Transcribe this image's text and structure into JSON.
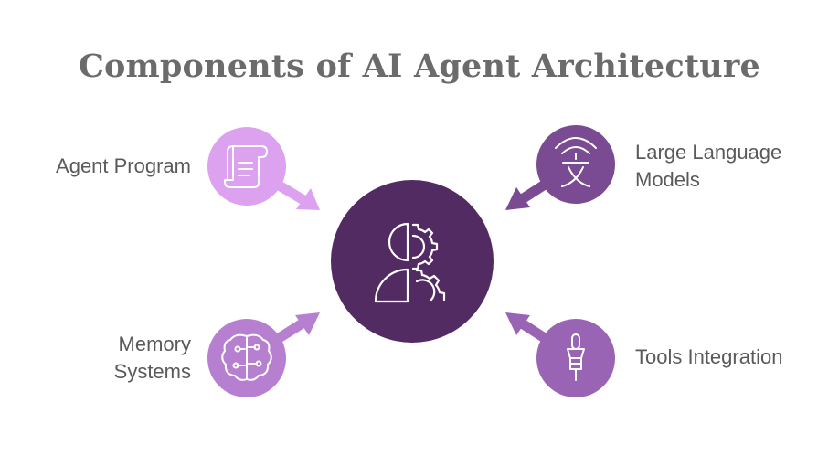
{
  "title": "Components of AI Agent Architecture",
  "center": {
    "icon": "head-gear-icon"
  },
  "components": [
    {
      "id": "agent-program",
      "label": "Agent Program",
      "icon": "scroll-icon",
      "color": "#dca2f0"
    },
    {
      "id": "llm",
      "label_lines": [
        "Large Language",
        "Models"
      ],
      "icon": "language-signal-icon",
      "color": "#7a4a92"
    },
    {
      "id": "memory",
      "label_lines": [
        "Memory",
        "Systems"
      ],
      "icon": "brain-circuit-icon",
      "color": "#b77fd0"
    },
    {
      "id": "tools",
      "label": "Tools Integration",
      "icon": "tool-plug-icon",
      "color": "#9a64b4"
    }
  ],
  "colors": {
    "center": "#532b63",
    "title": "#6b6b6b",
    "text": "#5a5a5a"
  }
}
